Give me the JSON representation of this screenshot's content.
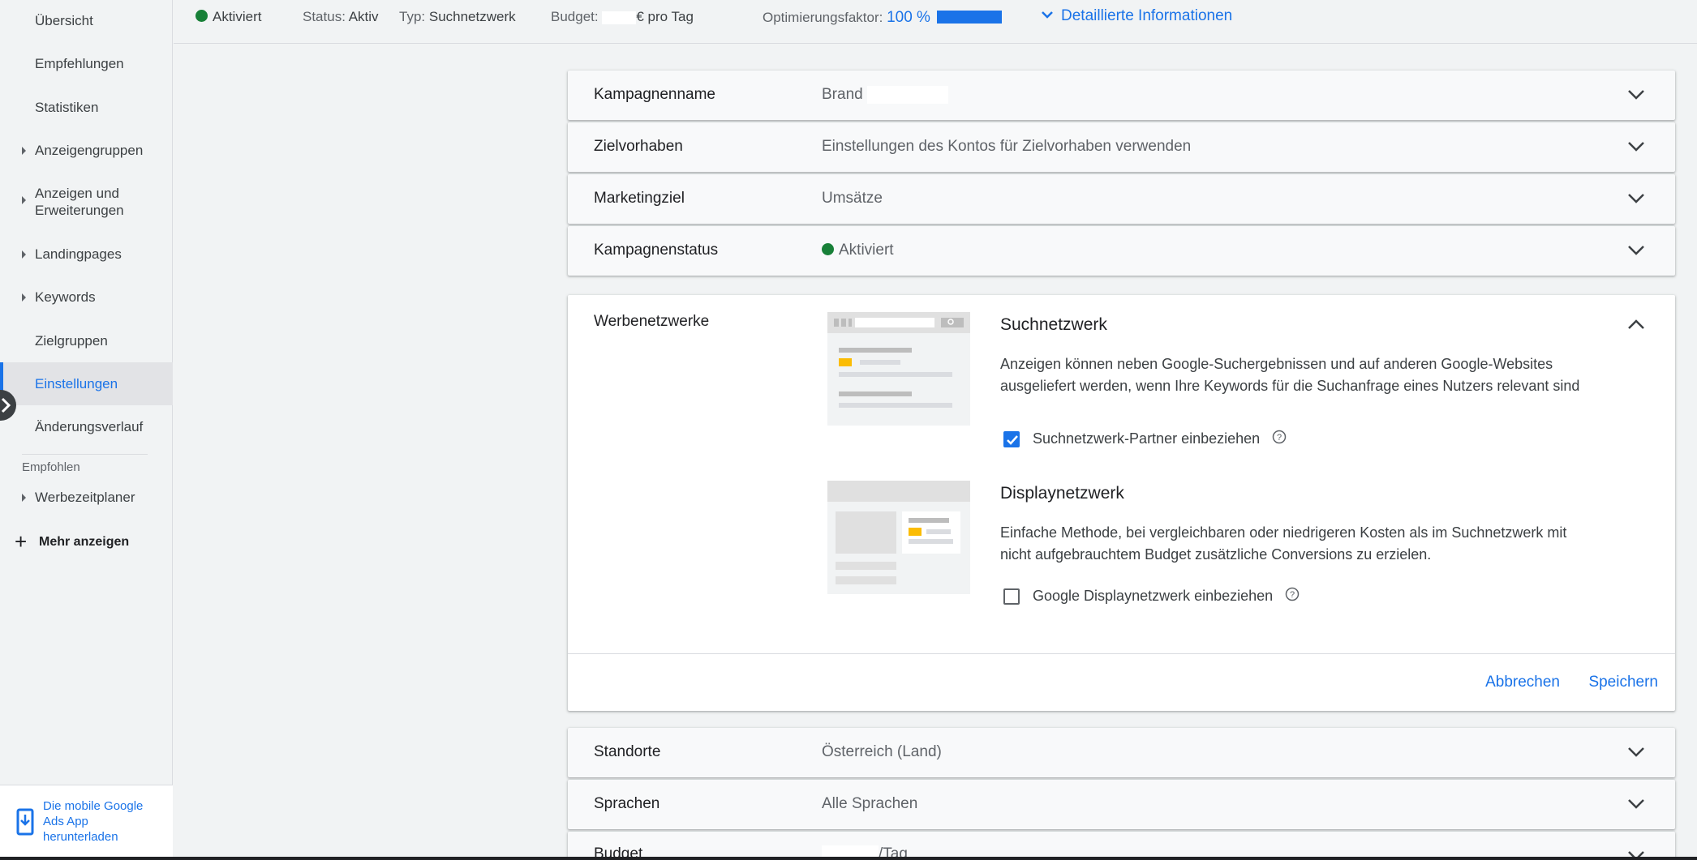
{
  "sidebar": {
    "items": [
      {
        "label": "Übersicht",
        "has_arrow": false
      },
      {
        "label": "Empfehlungen",
        "has_arrow": false
      },
      {
        "label": "Statistiken",
        "has_arrow": false
      },
      {
        "label": "Anzeigengruppen",
        "has_arrow": true
      },
      {
        "label": "Anzeigen und Erweiterungen",
        "has_arrow": true
      },
      {
        "label": "Landingpages",
        "has_arrow": true
      },
      {
        "label": "Keywords",
        "has_arrow": true
      },
      {
        "label": "Zielgruppen",
        "has_arrow": false
      },
      {
        "label": "Einstellungen",
        "has_arrow": false,
        "active": true
      },
      {
        "label": "Änderungsverlauf",
        "has_arrow": false
      }
    ],
    "section_label": "Empfohlen",
    "recommended_item": "Werbezeitplaner",
    "more_label": "Mehr anzeigen",
    "app_promo": "Die mobile Google Ads App herunterladen"
  },
  "topbar": {
    "status_badge": "Aktiviert",
    "status_label": "Status:",
    "status_value": "Aktiv",
    "type_label": "Typ:",
    "type_value": "Suchnetzwerk",
    "budget_label": "Budget:",
    "budget_suffix": "€ pro Tag",
    "optimization_label": "Optimierungsfaktor:",
    "optimization_value": "100 %",
    "optimization_fraction": 1.0,
    "details_link": "Detaillierte Informationen"
  },
  "settings": {
    "campaign_name": {
      "label": "Kampagnenname",
      "value": "Brand"
    },
    "goals": {
      "label": "Zielvorhaben",
      "value": "Einstellungen des Kontos für Zielvorhaben verwenden"
    },
    "marketing_goal": {
      "label": "Marketingziel",
      "value": "Umsätze"
    },
    "campaign_status": {
      "label": "Kampagnenstatus",
      "value": "Aktiviert"
    },
    "networks": {
      "label": "Werbenetzwerke",
      "search": {
        "title": "Suchnetzwerk",
        "description": "Anzeigen können neben Google-Suchergebnissen und auf anderen Google-Websites ausgeliefert werden, wenn Ihre Keywords für die Suchanfrage eines Nutzers relevant sind",
        "checkbox_label": "Suchnetzwerk-Partner einbeziehen",
        "checked": true
      },
      "display": {
        "title": "Displaynetzwerk",
        "description": "Einfache Methode, bei vergleichbaren oder niedrigeren Kosten als im Suchnetzwerk mit nicht aufgebrauchtem Budget zusätzliche Conversions zu erzielen.",
        "checkbox_label": "Google Displaynetzwerk einbeziehen",
        "checked": false
      },
      "cancel_label": "Abbrechen",
      "save_label": "Speichern"
    },
    "locations": {
      "label": "Standorte",
      "value": "Österreich (Land)"
    },
    "languages": {
      "label": "Sprachen",
      "value": "Alle Sprachen"
    },
    "budget": {
      "label": "Budget",
      "value": "/Tag"
    }
  },
  "colors": {
    "accent": "#1a73e8",
    "status_green": "#188038",
    "highlight_yellow": "#fbbc04"
  }
}
